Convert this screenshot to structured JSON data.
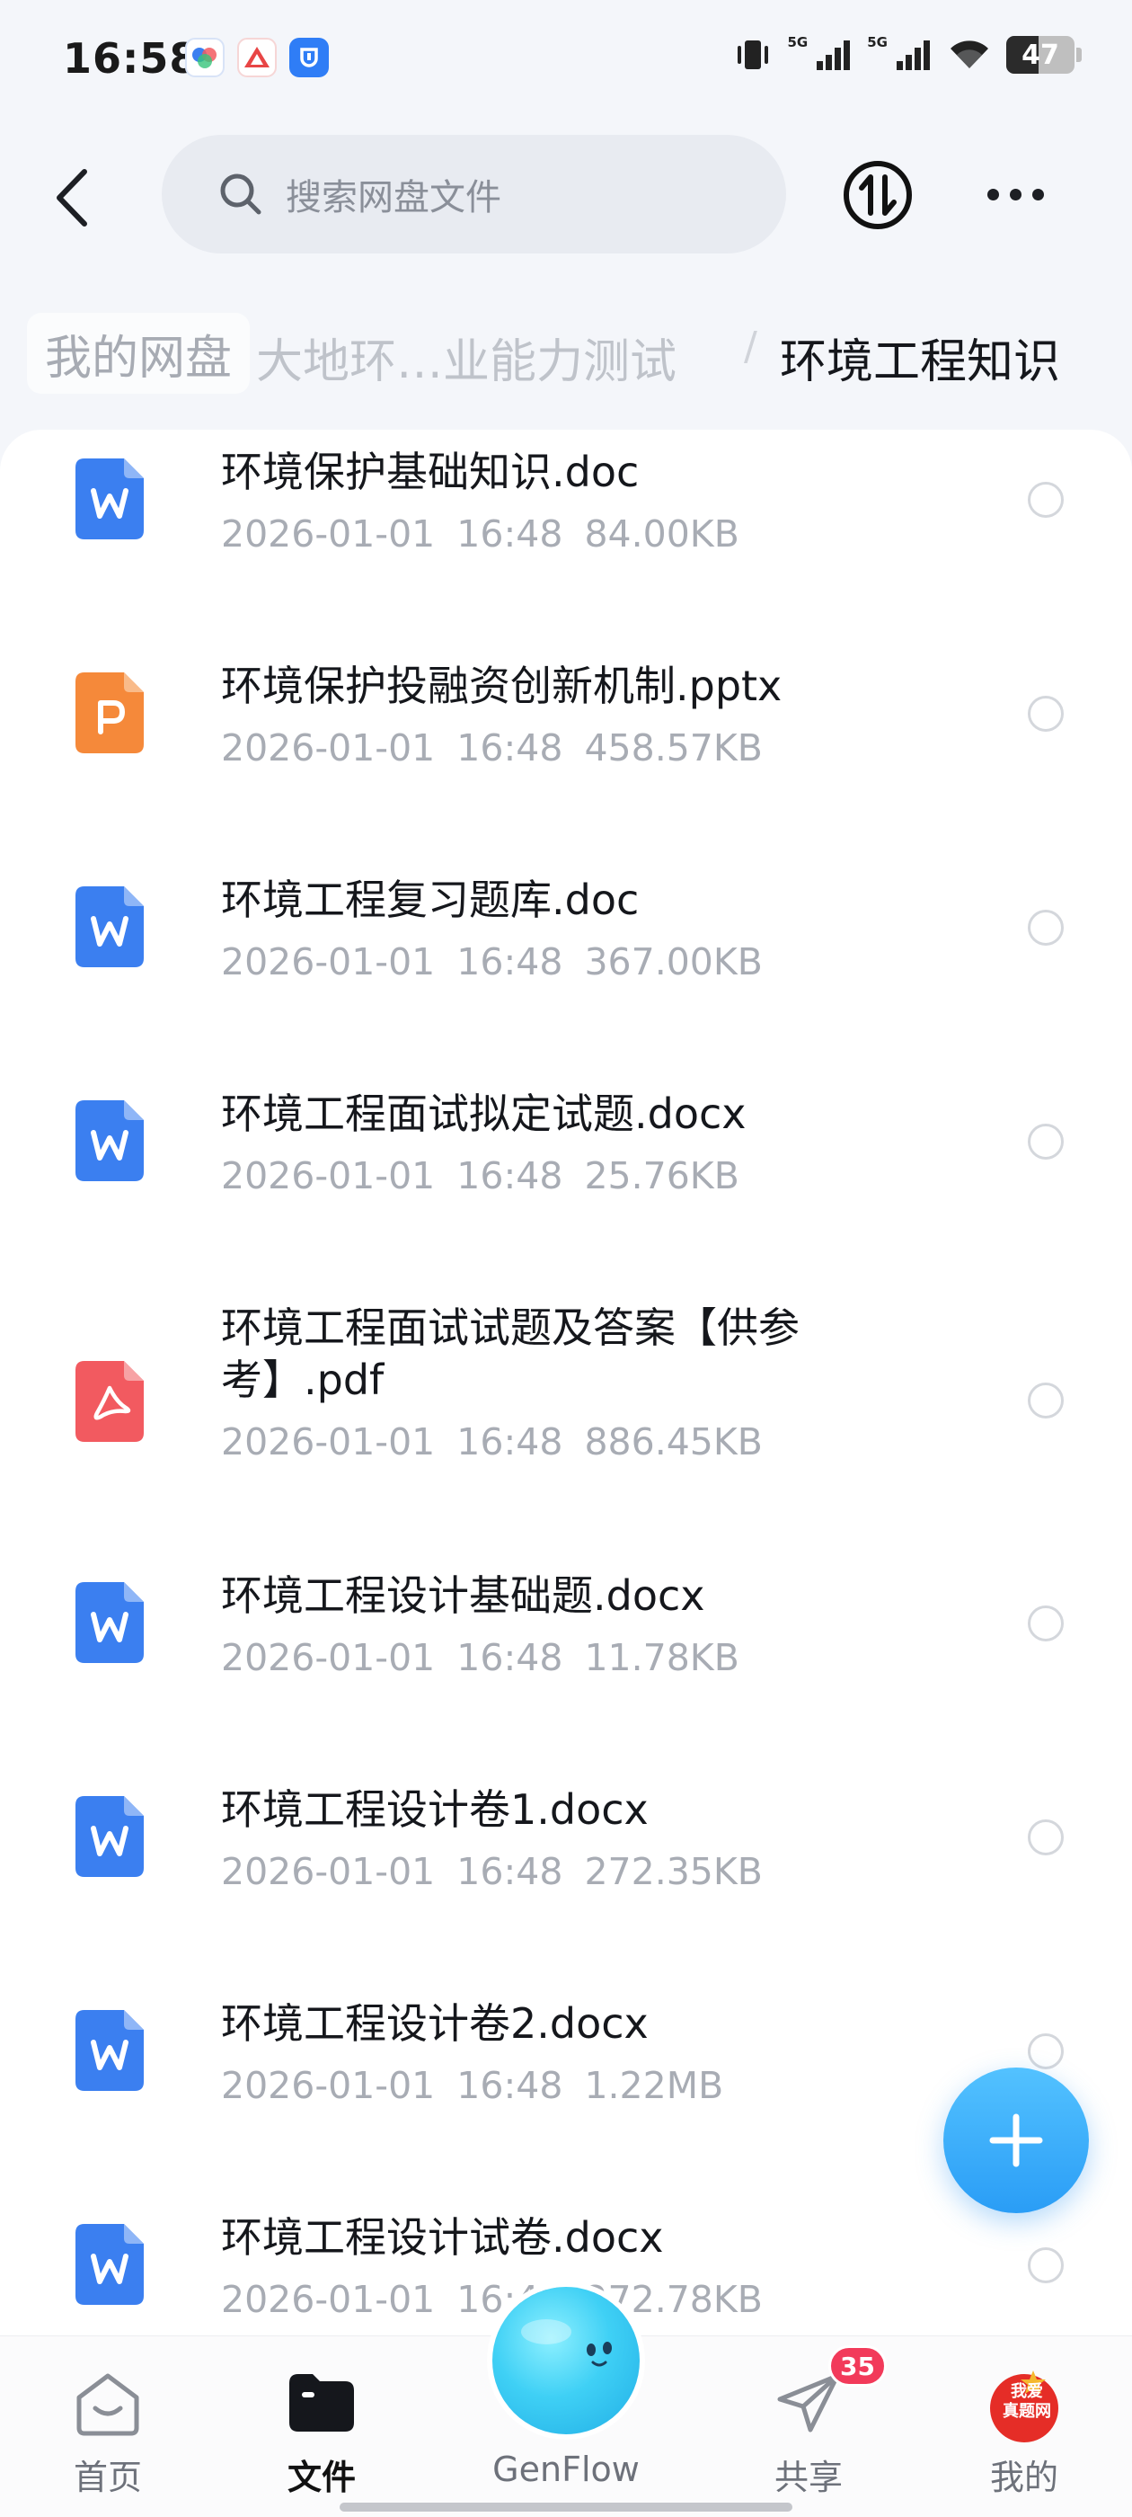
{
  "status_bar": {
    "time": "16:58",
    "signal_1_label": "5G",
    "signal_2_label": "5G",
    "battery_level": "47",
    "battery_fraction": 0.47
  },
  "header": {
    "search_placeholder": "搜索网盘文件"
  },
  "breadcrumb": {
    "root": "我的网盘",
    "middle": "大地环…业能力测试",
    "separator": "/",
    "current": "环境工程知识"
  },
  "files": [
    {
      "name": "环境保护基础知识.doc",
      "date": "2026-01-01",
      "time": "16:48",
      "size": "84.00KB",
      "type": "word"
    },
    {
      "name": "环境保护投融资创新机制.pptx",
      "date": "2026-01-01",
      "time": "16:48",
      "size": "458.57KB",
      "type": "ppt"
    },
    {
      "name": "环境工程复习题库.doc",
      "date": "2026-01-01",
      "time": "16:48",
      "size": "367.00KB",
      "type": "word"
    },
    {
      "name": "环境工程面试拟定试题.docx",
      "date": "2026-01-01",
      "time": "16:48",
      "size": "25.76KB",
      "type": "word"
    },
    {
      "name_line1": "环境工程面试试题及答案【供参",
      "name_line2": "考】.pdf",
      "date": "2026-01-01",
      "time": "16:48",
      "size": "886.45KB",
      "type": "pdf"
    },
    {
      "name": "环境工程设计基础题.docx",
      "date": "2026-01-01",
      "time": "16:48",
      "size": "11.78KB",
      "type": "word"
    },
    {
      "name": "环境工程设计卷1.docx",
      "date": "2026-01-01",
      "time": "16:48",
      "size": "272.35KB",
      "type": "word"
    },
    {
      "name": "环境工程设计卷2.docx",
      "date": "2026-01-01",
      "time": "16:48",
      "size": "1.22MB",
      "type": "word"
    },
    {
      "name": "环境工程设计试卷.docx",
      "date": "2026-01-01",
      "time": "16:48",
      "size": "272.78KB",
      "type": "word"
    }
  ],
  "icons": {
    "word_color": "#3b7ff0",
    "ppt_color": "#f5893a",
    "pdf_color": "#f25a60",
    "accent": "#2a9df6"
  },
  "bottom_nav": {
    "home": "首页",
    "files": "文件",
    "genflow": "GenFlow",
    "share": "共享",
    "share_badge": "35",
    "me": "我的",
    "me_avatar_text": "我爱真题网"
  }
}
